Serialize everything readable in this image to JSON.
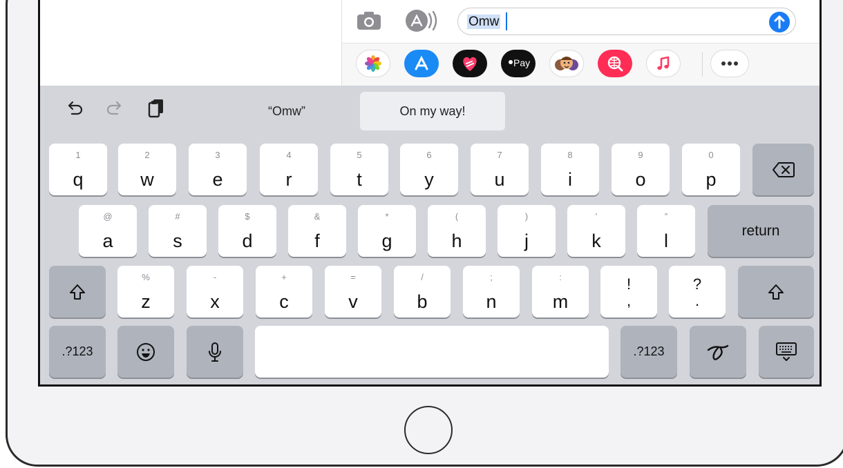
{
  "message": {
    "input_value": "Omw"
  },
  "app_drawer": {
    "items": [
      {
        "name": "photos-app-icon"
      },
      {
        "name": "app-store-app-icon"
      },
      {
        "name": "digital-touch-app-icon"
      },
      {
        "name": "apple-pay-app-icon",
        "label": "Pay"
      },
      {
        "name": "memoji-app-icon"
      },
      {
        "name": "web-images-app-icon"
      },
      {
        "name": "music-app-icon"
      },
      {
        "name": "more-apps-icon"
      }
    ]
  },
  "keyboard": {
    "suggestions": [
      {
        "label": "“Omw”",
        "selected": false
      },
      {
        "label": "On my way!",
        "selected": true
      }
    ],
    "row1": [
      {
        "hint": "1",
        "key": "q"
      },
      {
        "hint": "2",
        "key": "w"
      },
      {
        "hint": "3",
        "key": "e"
      },
      {
        "hint": "4",
        "key": "r"
      },
      {
        "hint": "5",
        "key": "t"
      },
      {
        "hint": "6",
        "key": "y"
      },
      {
        "hint": "7",
        "key": "u"
      },
      {
        "hint": "8",
        "key": "i"
      },
      {
        "hint": "9",
        "key": "o"
      },
      {
        "hint": "0",
        "key": "p"
      }
    ],
    "row2": [
      {
        "hint": "@",
        "key": "a"
      },
      {
        "hint": "#",
        "key": "s"
      },
      {
        "hint": "$",
        "key": "d"
      },
      {
        "hint": "&",
        "key": "f"
      },
      {
        "hint": "*",
        "key": "g"
      },
      {
        "hint": "(",
        "key": "h"
      },
      {
        "hint": ")",
        "key": "j"
      },
      {
        "hint": "’",
        "key": "k"
      },
      {
        "hint": "”",
        "key": "l"
      }
    ],
    "return_label": "return",
    "row3": [
      {
        "hint": "%",
        "key": "z"
      },
      {
        "hint": "-",
        "key": "x"
      },
      {
        "hint": "+",
        "key": "c"
      },
      {
        "hint": "=",
        "key": "v"
      },
      {
        "hint": "/",
        "key": "b"
      },
      {
        "hint": ";",
        "key": "n"
      },
      {
        "hint": ":",
        "key": "m"
      }
    ],
    "punct_keys": [
      {
        "top": "!",
        "bottom": ","
      },
      {
        "top": "?",
        "bottom": "."
      }
    ],
    "numbers_label": ".?123",
    "colors": {
      "keyboard_bg": "#d3d5db",
      "letter_key": "#ffffff",
      "function_key": "#aeb3bc",
      "send_button": "#1a7cf5"
    }
  }
}
